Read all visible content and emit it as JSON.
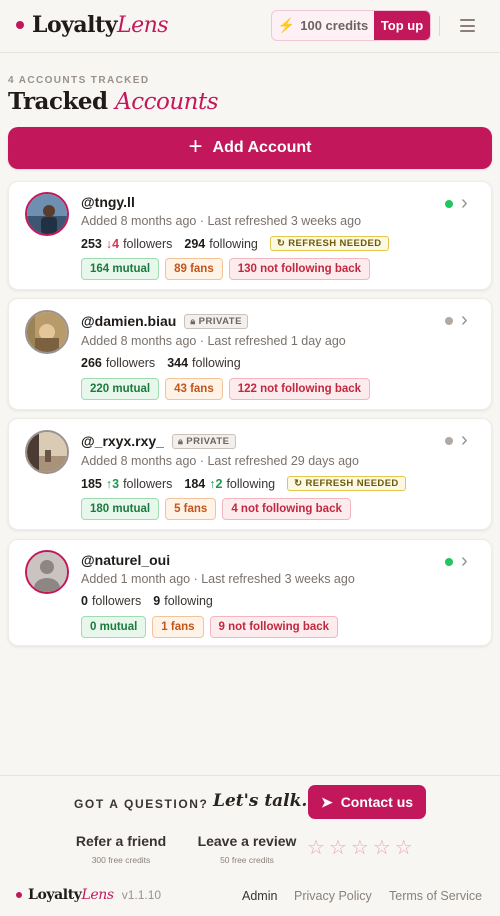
{
  "brand": {
    "name_main": "Loyalty",
    "name_accent": "Lens",
    "color": "#c2185b"
  },
  "header": {
    "credits_label": "100 credits",
    "topup_label": "Top up",
    "bolt_icon": "lightning-icon",
    "menu_icon": "hamburger-icon"
  },
  "page": {
    "count_label": "4 ACCOUNTS TRACKED",
    "title_main": "Tracked",
    "title_accent": "Accounts",
    "add_label": "Add Account"
  },
  "accounts": [
    {
      "handle": "@tngy.ll",
      "private": false,
      "meta": "Added 8 months ago · Last refreshed 3 weeks ago",
      "followers": "253",
      "followers_delta": "↓4",
      "following": "294",
      "following_delta": "",
      "refresh_needed": true,
      "mutual": "164 mutual",
      "fans": "89 fans",
      "notback": "130 not following back",
      "status": "online"
    },
    {
      "handle": "@damien.biau",
      "private": true,
      "meta": "Added 8 months ago · Last refreshed 1 day ago",
      "followers": "266",
      "followers_delta": "",
      "following": "344",
      "following_delta": "",
      "refresh_needed": false,
      "mutual": "220 mutual",
      "fans": "43 fans",
      "notback": "122 not following back",
      "status": "offline"
    },
    {
      "handle": "@_rxyx.rxy_",
      "private": true,
      "meta": "Added 8 months ago · Last refreshed 29 days ago",
      "followers": "185",
      "followers_delta": "↑3",
      "following": "184",
      "following_delta": "↑2",
      "refresh_needed": true,
      "mutual": "180 mutual",
      "fans": "5 fans",
      "notback": "4 not following back",
      "status": "offline"
    },
    {
      "handle": "@naturel_oui",
      "private": false,
      "meta": "Added 1 month ago · Last refreshed 3 weeks ago",
      "followers": "0",
      "followers_delta": "",
      "following": "9",
      "following_delta": "",
      "refresh_needed": false,
      "mutual": "0 mutual",
      "fans": "1 fans",
      "notback": "9 not following back",
      "status": "online"
    }
  ],
  "labels": {
    "followers": "followers",
    "following": "following",
    "private": "PRIVATE",
    "refresh_needed": "REFRESH NEEDED"
  },
  "footer": {
    "question": "GOT A QUESTION?",
    "lets_talk": "Let's talk.",
    "contact_label": "Contact us",
    "refer_title": "Refer a friend",
    "refer_sub": "300 free credits",
    "review_title": "Leave a review",
    "review_sub": "50 free credits",
    "rating_stars": 0,
    "version": "v1.1.10",
    "admin": "Admin",
    "privacy": "Privacy Policy",
    "terms": "Terms of Service"
  }
}
